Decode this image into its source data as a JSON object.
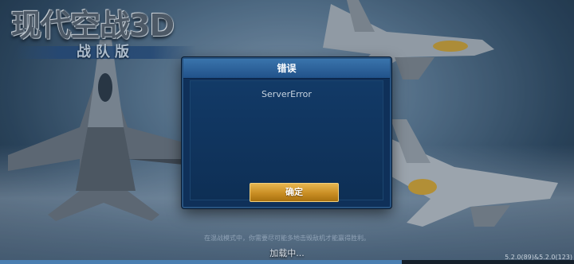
{
  "logo": {
    "title": "现代空战3D",
    "subtitle": "战队版"
  },
  "dialog": {
    "title": "错误",
    "message": "ServerError",
    "confirm_label": "确定"
  },
  "tip": "在混战模式中，你需要尽可能多地击毁敌机才能赢得胜利。",
  "loading_text": "加载中...",
  "version": "5.2.0(89)&5.2.0(123)",
  "loading_progress": 0.7,
  "colors": {
    "dialog_bg": "#0f3059",
    "dialog_header": "#2d6299",
    "confirm_button": "#d29a32"
  }
}
